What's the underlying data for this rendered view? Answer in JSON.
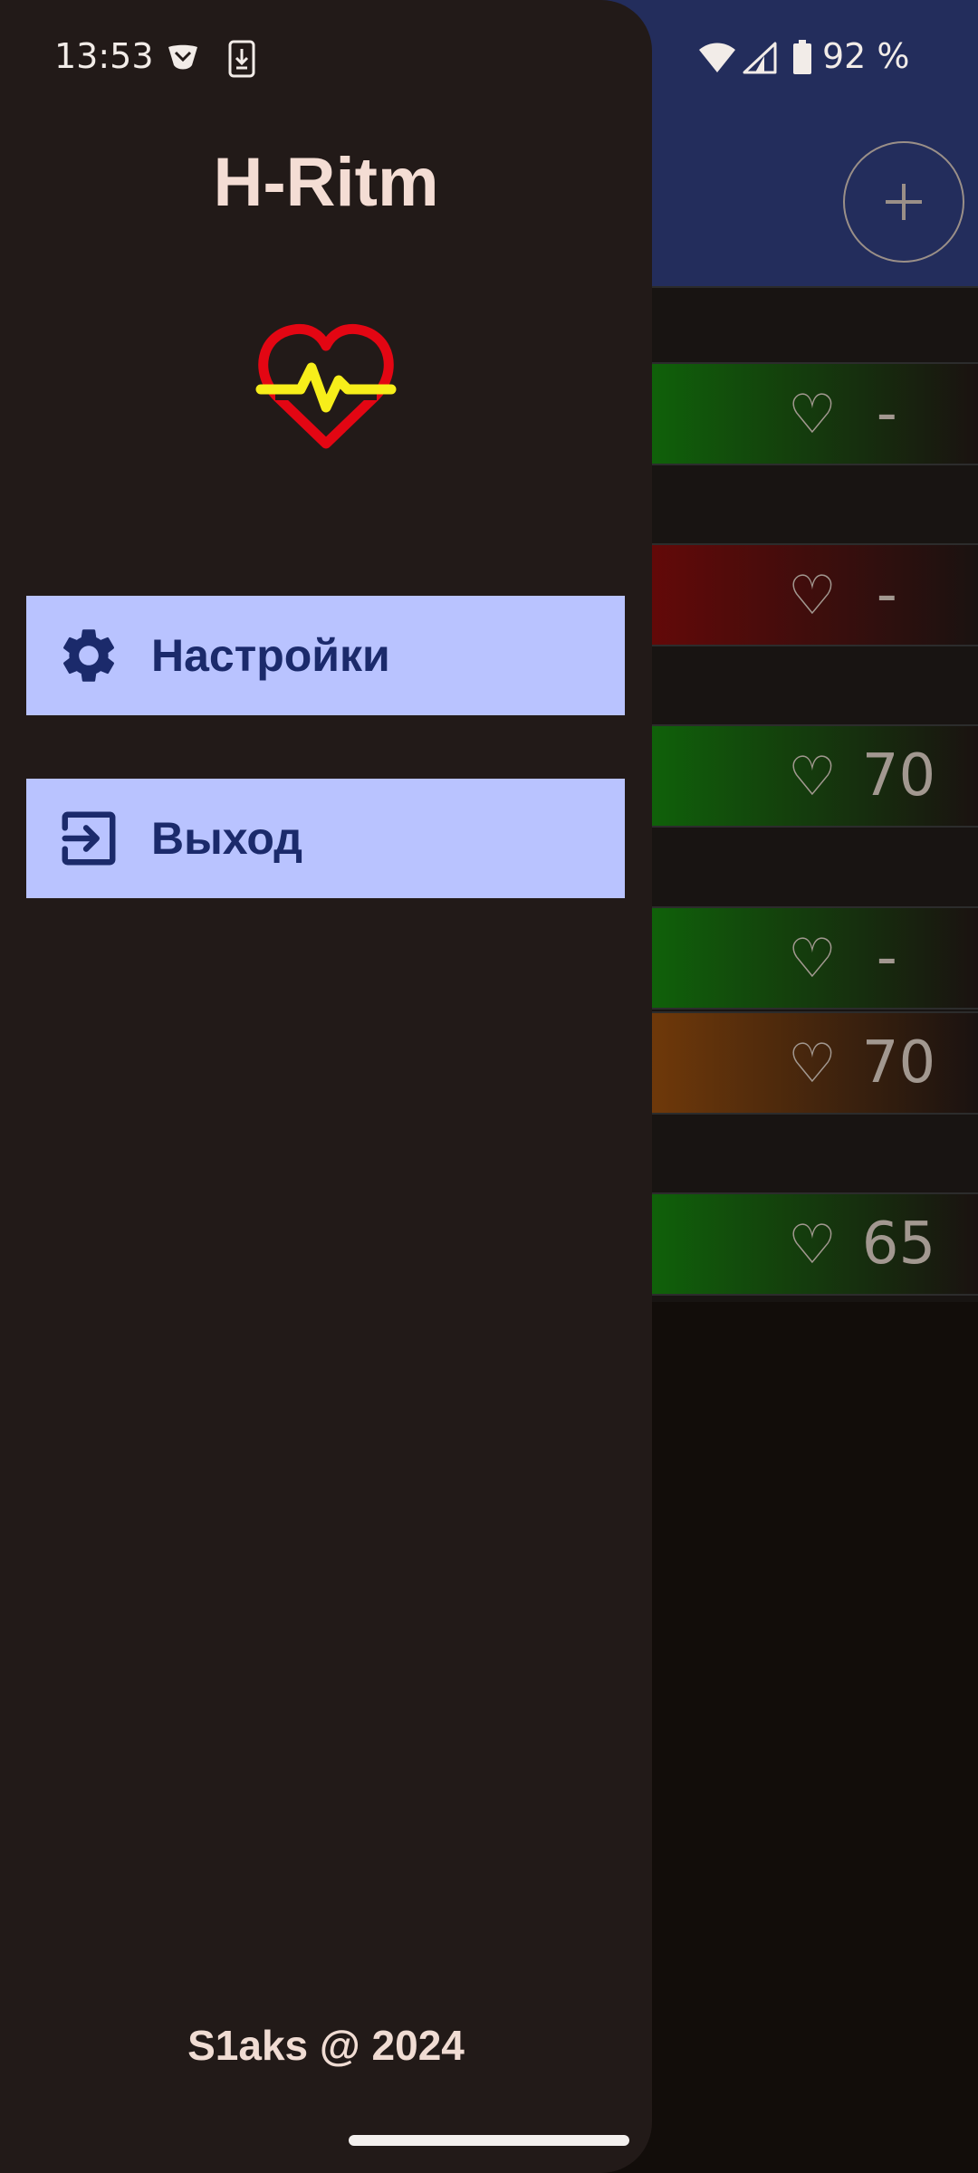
{
  "status_bar": {
    "time": "13:53",
    "battery": "92 %",
    "icons": [
      "nfc-icon",
      "install-icon",
      "wifi-icon",
      "signal-icon",
      "battery-icon"
    ]
  },
  "drawer": {
    "title": "H-Ritm",
    "logo": "heart-pulse-icon",
    "menu": [
      {
        "label": "Настройки",
        "icon": "gear-icon"
      },
      {
        "label": "Выход",
        "icon": "logout-icon"
      }
    ],
    "footer": "S1aks @ 2024"
  },
  "background_list": {
    "add_icon": "plus-icon",
    "rows": [
      {
        "symbol": "♡",
        "value": "-",
        "status_color": "#0c7a08"
      },
      {
        "symbol": "♡",
        "value": "-",
        "status_color": "#7a0606"
      },
      {
        "symbol": "♡",
        "value": "70",
        "status_color": "#0c7a08"
      },
      {
        "symbol": "♡",
        "value": "-",
        "status_color": "#0c7a08"
      },
      {
        "symbol": "♡",
        "value": "70",
        "status_color": "#8a4508"
      },
      {
        "symbol": "♡",
        "value": "65",
        "status_color": "#0c7a08"
      }
    ]
  },
  "colors": {
    "drawer_bg": "#221a18",
    "header_bg": "#232d5c",
    "menu_bg": "#b9c3ff",
    "menu_text": "#1b2a6b",
    "logo_red": "#e30613",
    "logo_yellow": "#f7ee1a"
  }
}
